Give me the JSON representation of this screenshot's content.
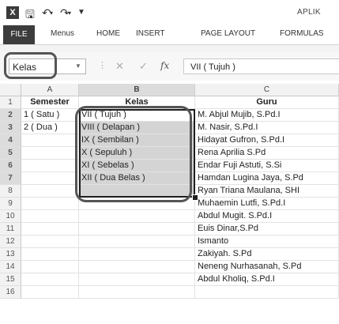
{
  "titlebar": {
    "logo": "X",
    "app_title": "APLIK",
    "quick_access": [
      "save-icon",
      "undo-icon",
      "redo-icon",
      "customize-icon"
    ]
  },
  "ribbon": {
    "tabs": [
      "FILE",
      "Menus",
      "HOME",
      "INSERT",
      "PAGE LAYOUT",
      "FORMULAS"
    ]
  },
  "formula_bar": {
    "name_box": "Kelas",
    "cancel": "✕",
    "enter": "✓",
    "fx": "fx",
    "value": "VII ( Tujuh )"
  },
  "columns": [
    "A",
    "B",
    "C"
  ],
  "rows": [
    "1",
    "2",
    "3",
    "4",
    "5",
    "6",
    "7",
    "8",
    "9",
    "10",
    "11",
    "12",
    "13",
    "14",
    "15",
    "16"
  ],
  "header_row": {
    "a": "Semester",
    "b": "Kelas",
    "c": "Guru"
  },
  "col_a": [
    "1 ( Satu )",
    "2 ( Dua )"
  ],
  "col_b": [
    "VII ( Tujuh )",
    "VIII ( Delapan )",
    "IX ( Sembilan )",
    "X ( Sepuluh )",
    "XI ( Sebelas )",
    "XII ( Dua Belas )"
  ],
  "col_c": [
    "M. Abjul Mujib, S.Pd.I",
    "M. Nasir, S.Pd.I",
    "Hidayat Gufron, S.Pd.I",
    "Rena Aprilia S.Pd",
    "Endar Fuji Astuti, S.Si",
    "Hamdan Lugina Jaya, S.Pd",
    "Ryan Triana Maulana, SHI",
    "Muhaemin Lutfi, S.Pd.I",
    "Abdul Mugit. S.Pd.I",
    "Euis Dinar,S.Pd",
    "Ismanto",
    "Zakiyah. S.Pd",
    "Neneng Nurhasanah, S.Pd",
    "Abdul Kholiq, S.Pd.I"
  ]
}
